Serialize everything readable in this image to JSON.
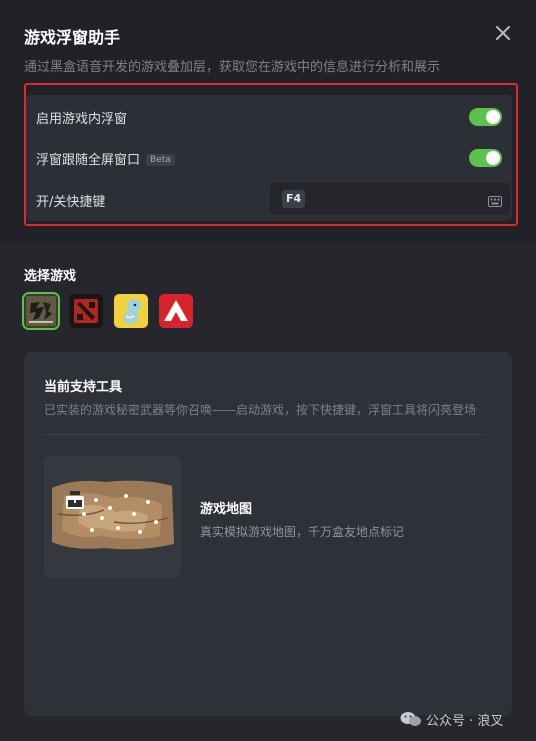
{
  "window": {
    "title": "游戏浮窗助手",
    "subtitle": "通过黑盒语音开发的游戏叠加层，获取您在游戏中的信息进行分析和展示"
  },
  "settings": {
    "overlay_label": "启用游戏内浮窗",
    "overlay_enabled": true,
    "follow_label": "浮窗跟随全屏窗口",
    "follow_badge": "Beta",
    "follow_enabled": true,
    "hotkey_label": "开/关快捷键",
    "hotkey_value": "F4"
  },
  "game_select": {
    "title": "选择游戏",
    "games": [
      {
        "icon": "game-wuxia-icon",
        "selected": true
      },
      {
        "icon": "dota2-icon",
        "selected": false
      },
      {
        "icon": "pokemon-icon",
        "selected": false
      },
      {
        "icon": "apex-icon",
        "selected": false
      }
    ]
  },
  "tools": {
    "title": "当前支持工具",
    "description": "已实装的游戏秘密武器等你召唤——启动游戏，按下快捷键，浮窗工具将闪亮登场",
    "items": [
      {
        "name": "游戏地图",
        "description": "真实模拟游戏地图，千万盒友地点标记",
        "icon": "map-thumbnail"
      }
    ]
  },
  "watermark": {
    "text": "公众号 · 浪叉"
  },
  "colors": {
    "accent_green": "#5cc24e",
    "highlight_red": "#e02828",
    "background": "#25272d"
  }
}
